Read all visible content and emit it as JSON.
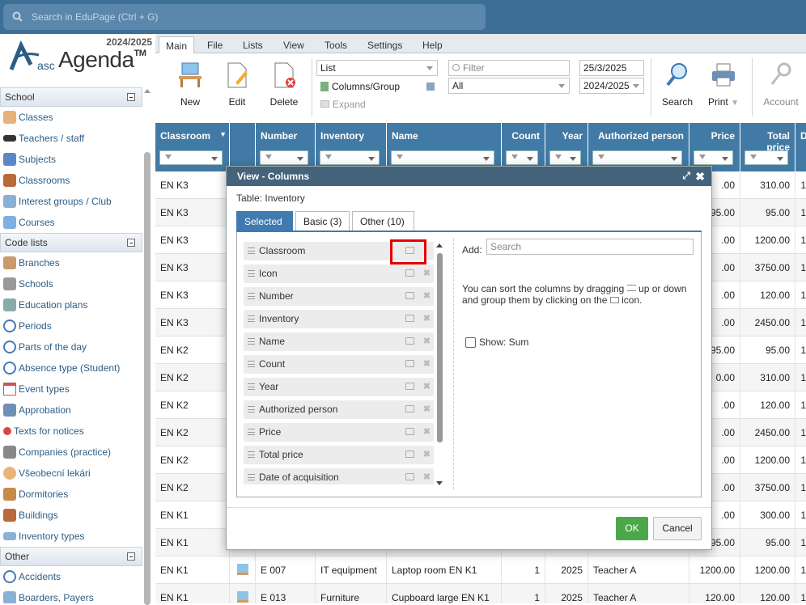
{
  "search": {
    "placeholder": "Search in EduPage (Ctrl + G)"
  },
  "logo": {
    "year": "2024/2025",
    "asc": "asc",
    "name": "Agenda",
    "tm": "TM"
  },
  "sidebar": {
    "school": {
      "title": "School",
      "items": [
        "Classes",
        "Teachers / staff",
        "Subjects",
        "Classrooms",
        "Interest groups / Club",
        "Courses"
      ]
    },
    "codelists": {
      "title": "Code lists",
      "items": [
        "Branches",
        "Schools",
        "Education plans",
        "Periods",
        "Parts of the day",
        "Absence type (Student)",
        "Event types",
        "Approbation",
        "Texts for notices",
        "Companies (practice)",
        "Všeobecní lekári",
        "Dormitories",
        "Buildings",
        "Inventory types"
      ]
    },
    "other": {
      "title": "Other",
      "items": [
        "Accidents",
        "Boarders, Payers"
      ]
    }
  },
  "menu": {
    "tabs": [
      "Main",
      "File",
      "Lists",
      "View",
      "Tools",
      "Settings",
      "Help"
    ]
  },
  "toolbar": {
    "new": "New",
    "edit": "Edit",
    "delete": "Delete",
    "view_combo": "List",
    "columns_group": "Columns/Group",
    "expand": "Expand",
    "filter_placeholder": "Filter",
    "filter_value": "All",
    "date": "25/3/2025",
    "year": "2024/2025",
    "search": "Search",
    "print": "Print",
    "account": "Account"
  },
  "grid": {
    "headers": [
      "Classroom",
      "",
      "Number",
      "Inventory",
      "Name",
      "Count",
      "Year",
      "Authorized person",
      "Price",
      "Total price",
      "D"
    ],
    "rows": [
      [
        "EN K3",
        "",
        "",
        "",
        "",
        "",
        "",
        "",
        ".00",
        "310.00",
        "1"
      ],
      [
        "EN K3",
        "",
        "",
        "",
        "",
        "",
        "",
        "",
        "95.00",
        "95.00",
        "1"
      ],
      [
        "EN K3",
        "",
        "",
        "",
        "",
        "",
        "",
        "",
        ".00",
        "1200.00",
        "1"
      ],
      [
        "EN K3",
        "",
        "",
        "",
        "",
        "",
        "",
        "",
        ".00",
        "3750.00",
        "1"
      ],
      [
        "EN K3",
        "",
        "",
        "",
        "",
        "",
        "",
        "",
        ".00",
        "120.00",
        "1"
      ],
      [
        "EN K3",
        "",
        "",
        "",
        "",
        "",
        "",
        "",
        ".00",
        "2450.00",
        "1"
      ],
      [
        "EN K2",
        "",
        "",
        "",
        "",
        "",
        "",
        "",
        "95.00",
        "95.00",
        "1"
      ],
      [
        "EN K2",
        "",
        "",
        "",
        "",
        "",
        "",
        "",
        "0.00",
        "310.00",
        "1"
      ],
      [
        "EN K2",
        "",
        "",
        "",
        "",
        "",
        "",
        "",
        ".00",
        "120.00",
        "1"
      ],
      [
        "EN K2",
        "",
        "",
        "",
        "",
        "",
        "",
        "",
        ".00",
        "2450.00",
        "1"
      ],
      [
        "EN K2",
        "",
        "",
        "",
        "",
        "",
        "",
        "",
        ".00",
        "1200.00",
        "1"
      ],
      [
        "EN K2",
        "",
        "",
        "",
        "",
        "",
        "",
        "",
        ".00",
        "3750.00",
        "1"
      ],
      [
        "EN K1",
        "",
        "",
        "",
        "",
        "",
        "",
        "",
        ".00",
        "300.00",
        "1"
      ],
      [
        "EN K1",
        "",
        "",
        "",
        "",
        "",
        "",
        "",
        "95.00",
        "95.00",
        "1"
      ],
      [
        "EN K1",
        "",
        "E 007",
        "IT equipment",
        "Laptop room EN K1",
        "1",
        "2025",
        "Teacher A",
        "1200.00",
        "1200.00",
        "1"
      ],
      [
        "EN K1",
        "",
        "E 013",
        "Furniture",
        "Cupboard large EN K1",
        "1",
        "2025",
        "Teacher A",
        "120.00",
        "120.00",
        "1"
      ]
    ]
  },
  "modal": {
    "title": "View - Columns",
    "table_label": "Table: Inventory",
    "tabs": [
      "Selected",
      "Basic (3)",
      "Other (10)"
    ],
    "columns": [
      "Classroom",
      "Icon",
      "Number",
      "Inventory",
      "Name",
      "Count",
      "Year",
      "Authorized person",
      "Price",
      "Total price",
      "Date of acquisition"
    ],
    "add_label": "Add:",
    "add_placeholder": "Search",
    "help1": "You can sort the columns by dragging",
    "help2": "up or down and group them by clicking on the",
    "help3": "icon.",
    "show_sum": "Show: Sum",
    "ok": "OK",
    "cancel": "Cancel"
  },
  "colors": {
    "topbar": "#3d6e96",
    "header": "#427aa6",
    "modal_head": "#46637c",
    "ok": "#4aa84a",
    "highlight": "#e60000"
  }
}
